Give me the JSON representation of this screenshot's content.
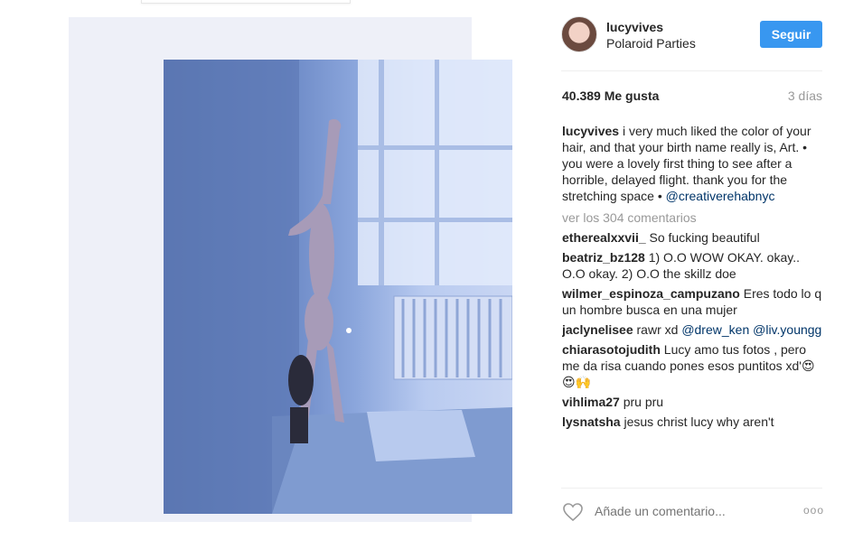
{
  "post": {
    "username": "lucyvives",
    "location": "Polaroid Parties",
    "follow_label": "Seguir",
    "likes": "40.389 Me gusta",
    "time": "3 días",
    "caption_user": "lucyvives",
    "caption_text": "i very much liked the color of your hair, and that your birth name really is, Art. • you were a lovely first thing to see after a horrible, delayed flight. thank you for the stretching space •",
    "caption_mention": "@creativerehabnyc",
    "view_all": "ver los 304 comentarios",
    "comments": [
      {
        "user": "etherealxxvii_",
        "text": "So fucking beautiful"
      },
      {
        "user": "beatriz_bz128",
        "text": "1) O.O WOW OKAY. okay.. O.O okay. 2) O.O the skillz doe"
      },
      {
        "user": "wilmer_espinoza_campuzano",
        "text": "Eres todo lo q un hombre busca en una mujer"
      },
      {
        "user": "jaclynelisee",
        "text": "rawr xd",
        "mention1": "@drew_ken",
        "mention2": "@liv.youngg"
      },
      {
        "user": "chiarasotojudith",
        "text": "Lucy amo tus fotos , pero me da risa cuando pones esos puntitos xd'😍😍🙌"
      },
      {
        "user": "vihlima27",
        "text": "pru pru"
      },
      {
        "user": "lysnatsha",
        "text": "jesus christ lucy why aren't"
      }
    ],
    "add_comment_placeholder": "Añade un comentario...",
    "more_label": "ooo"
  },
  "icons": {
    "heart": "heart-outline-icon",
    "more": "more-options-icon"
  },
  "colors": {
    "follow_button": "#3897f0",
    "mention": "#003569",
    "muted": "#999999"
  }
}
